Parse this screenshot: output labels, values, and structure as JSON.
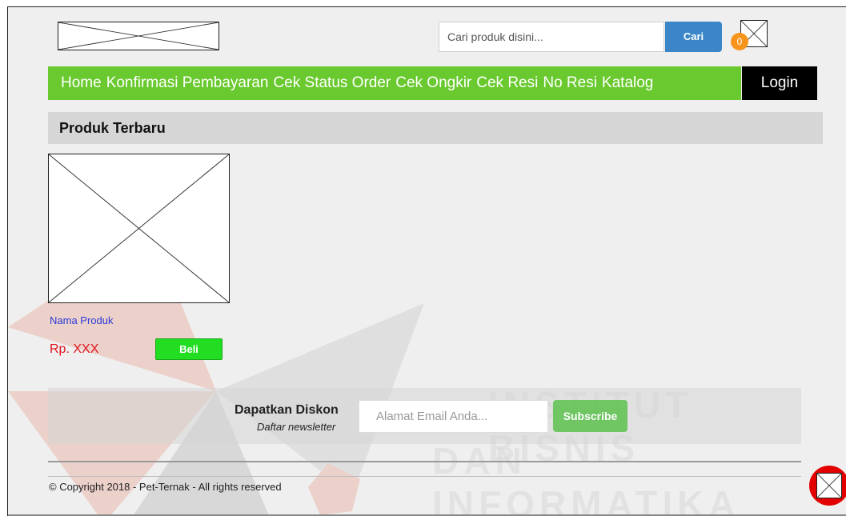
{
  "header": {
    "search_placeholder": "Cari produk disini...",
    "search_button": "Cari",
    "cart_count": "0"
  },
  "nav": {
    "items": [
      "Home",
      "Konfirmasi Pembayaran",
      "Cek Status Order",
      "Cek Ongkir",
      "Cek Resi",
      "No Resi",
      "Katalog"
    ],
    "login": "Login"
  },
  "section": {
    "title": "Produk Terbaru"
  },
  "product": {
    "name": "Nama Produk",
    "price": "Rp. XXX",
    "buy": "Beli"
  },
  "newsletter": {
    "title": "Dapatkan Diskon",
    "subtitle": "Daftar newsletter",
    "email_placeholder": "Alamat Email Anda...",
    "subscribe": "Subscribe"
  },
  "footer": {
    "copyright": "© Copyright 2018 - Pet-Ternak - All rights reserved"
  },
  "watermark": {
    "line1": "INSTITUT BISNIS",
    "line2": "DAN INFORMATIKA"
  },
  "colors": {
    "nav": "#6ac92f",
    "search_button": "#3a86c8",
    "buy": "#22dd22",
    "subscribe": "#69c55d",
    "price": "#e0141e",
    "badge": "#f7941d"
  }
}
